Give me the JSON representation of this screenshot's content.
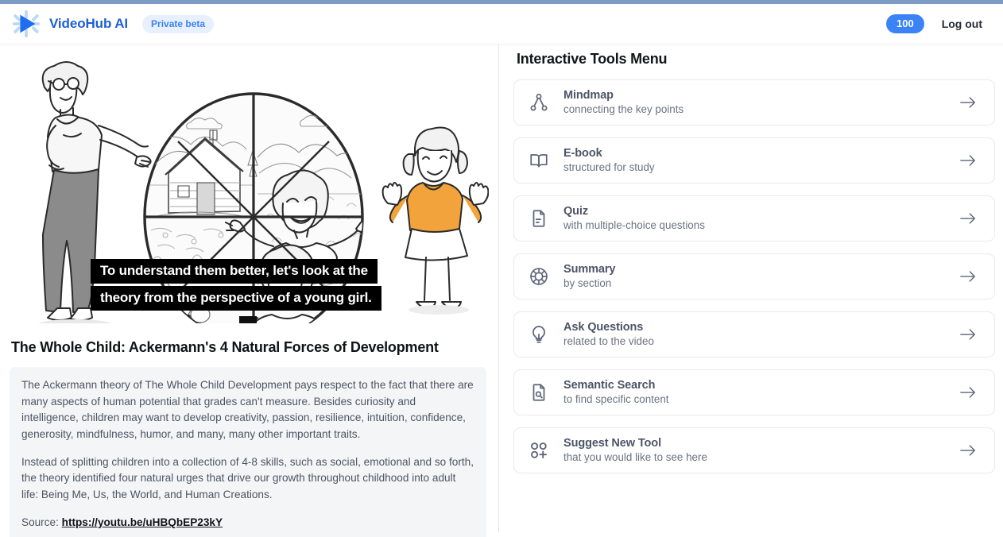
{
  "header": {
    "logo_icon": "play-sparkle-logo",
    "brand_name": "VideoHub AI",
    "beta_badge": "Private beta",
    "credits": "100",
    "logout_label": "Log out"
  },
  "video": {
    "caption_lines": [
      "To understand them better, let's look at the",
      "theory from the perspective of a young girl."
    ],
    "title": "The Whole Child: Ackermann's 4 Natural Forces of Development"
  },
  "transcript": {
    "paragraph1": "The Ackermann theory of The Whole Child Development pays respect to the fact that there are many aspects of human potential that grades can't measure. Besides curiosity and intelligence, children may want to develop creativity, passion, resilience, intuition, confidence, generosity, mindfulness, humor, and many, many other important traits.",
    "paragraph2": "Instead of splitting children into a collection of 4-8 skills, such as social, emotional and so forth, the theory identified four natural urges that drive our growth throughout childhood into adult life: Being Me, Us, the World, and Human Creations.",
    "source_label": "Source:",
    "source_url": "https://youtu.be/uHBQbEP23kY"
  },
  "tools": {
    "heading": "Interactive Tools Menu",
    "items": [
      {
        "name": "Mindmap",
        "desc": "connecting the key points",
        "icon": "mindmap-icon"
      },
      {
        "name": "E-book",
        "desc": "structured for study",
        "icon": "open-book-icon"
      },
      {
        "name": "Quiz",
        "desc": "with multiple-choice questions",
        "icon": "document-lines-icon"
      },
      {
        "name": "Summary",
        "desc": "by section",
        "icon": "life-ring-icon"
      },
      {
        "name": "Ask Questions",
        "desc": "related to the video",
        "icon": "lightbulb-icon"
      },
      {
        "name": "Semantic Search",
        "desc": "to find specific content",
        "icon": "document-search-icon"
      },
      {
        "name": "Suggest New Tool",
        "desc": "that you would like to see here",
        "icon": "add-grid-icon"
      }
    ],
    "arrow_icon": "arrow-right-icon"
  },
  "colors": {
    "brand_blue": "#1e5fd6",
    "accent_blue": "#3b82f6",
    "pill_bg": "#e8f0fe",
    "top_strip": "#7d9cc4",
    "transcript_bg": "#f4f5f7",
    "icon_slate": "#5c6478"
  }
}
